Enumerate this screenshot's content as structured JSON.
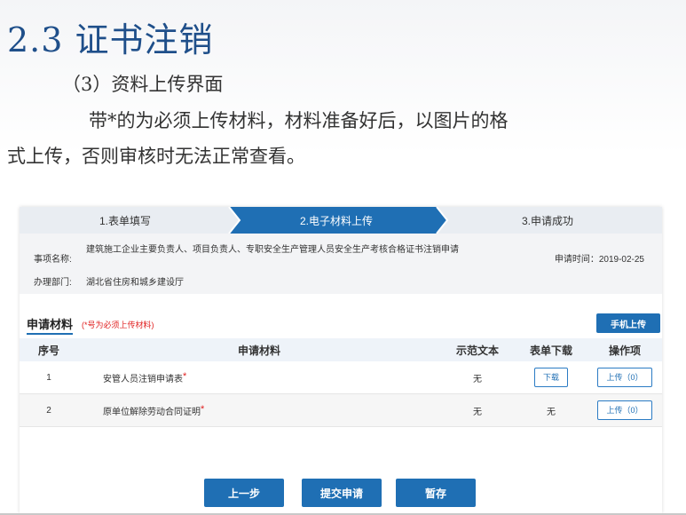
{
  "slide": {
    "title": "2.3 证书注销",
    "subtitle": "（3）资料上传界面",
    "para_line1": "带*的为必须上传材料，材料准备好后，以图片的格",
    "para_line2": "式上传，否则审核时无法正常查看。"
  },
  "steps": [
    "1.表单填写",
    "2.电子材料上传",
    "3.申请成功"
  ],
  "info": {
    "item_label": "事项名称:",
    "item_value": "建筑施工企业主要负责人、项目负责人、专职安全生产管理人员安全生产考核合格证书注销申请",
    "dept_label": "办理部门:",
    "dept_value": "湖北省住房和城乡建设厅",
    "time": "申请时间：2019-02-25"
  },
  "materials": {
    "heading": "申请材料",
    "note": "(*号为必须上传材料)",
    "mobile_upload": "手机上传",
    "columns": [
      "序号",
      "申请材料",
      "示范文本",
      "表单下载",
      "操作项"
    ],
    "rows": [
      {
        "no": "1",
        "name": "安管人员注销申请表",
        "required": "*",
        "sample": "无",
        "download": "下载",
        "action": "上传（0）"
      },
      {
        "no": "2",
        "name": "原单位解除劳动合同证明",
        "required": "*",
        "sample": "无",
        "download": "无",
        "action": "上传（0）"
      }
    ]
  },
  "buttons": {
    "prev": "上一步",
    "submit": "提交申请",
    "save": "暂存"
  },
  "colors": {
    "primary": "#1f6fb4",
    "title": "#1f4f8a",
    "required": "#e02020"
  }
}
